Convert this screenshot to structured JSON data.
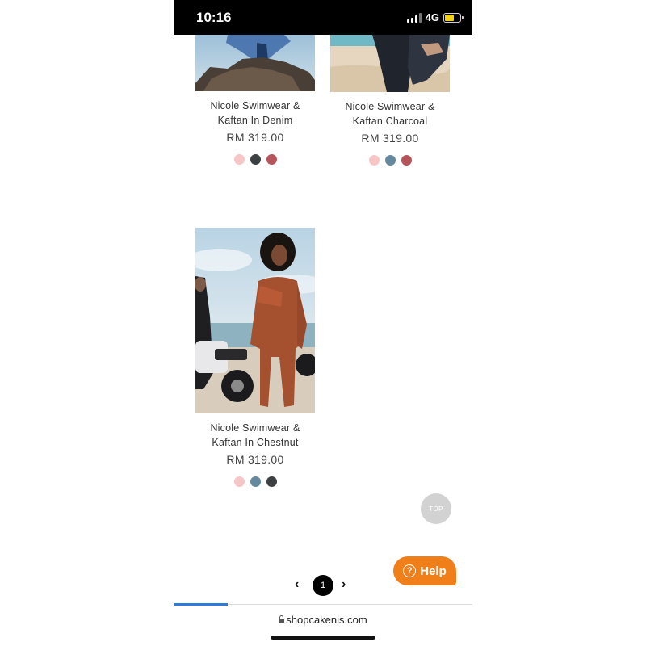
{
  "status_bar": {
    "time": "10:16",
    "network": "4G",
    "battery_level": 0.65
  },
  "products": [
    {
      "name_line1": "Nicole Swimwear &",
      "name_line2": "Kaftan In Denim",
      "price": "RM 319.00",
      "swatch_colors": [
        "#f6c6c6",
        "#3d4043",
        "#b5545a"
      ]
    },
    {
      "name_line1": "Nicole Swimwear &",
      "name_line2": "Kaftan Charcoal",
      "price": "RM 319.00",
      "swatch_colors": [
        "#f6c6c6",
        "#64899e",
        "#b5545a"
      ]
    },
    {
      "name_line1": "Nicole Swimwear &",
      "name_line2": "Kaftan In Chestnut",
      "price": "RM 319.00",
      "swatch_colors": [
        "#f6c6c6",
        "#64899e",
        "#3d4043"
      ]
    }
  ],
  "scroll_top_label": "TOP",
  "help": {
    "label": "Help",
    "icon": "?"
  },
  "pagination": {
    "prev_icon": "‹",
    "current_page": "1",
    "next_icon": "›"
  },
  "browser": {
    "url": "shopcakenis.com",
    "load_progress": 0.18
  },
  "colors": {
    "accent_help": "#f07f1a",
    "progress": "#2f7ce0"
  }
}
